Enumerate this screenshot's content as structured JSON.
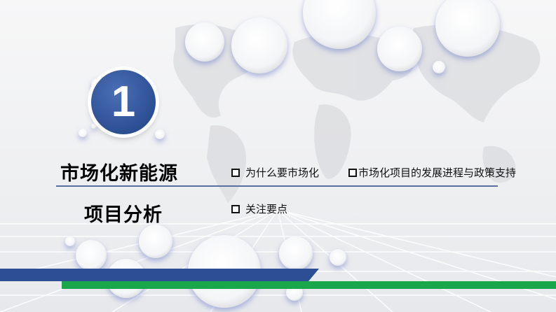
{
  "badge": {
    "number": "1"
  },
  "title": {
    "line1": "市场化新能源",
    "line2": "项目分析"
  },
  "items": [
    {
      "text": "为什么要市场化"
    },
    {
      "text": "市场化项目的发展进程与政策支持"
    },
    {
      "text": "关注要点"
    }
  ],
  "colors": {
    "accent_blue": "#2c4f94",
    "accent_green": "#1aa64b",
    "divider": "#5a6fa0"
  }
}
